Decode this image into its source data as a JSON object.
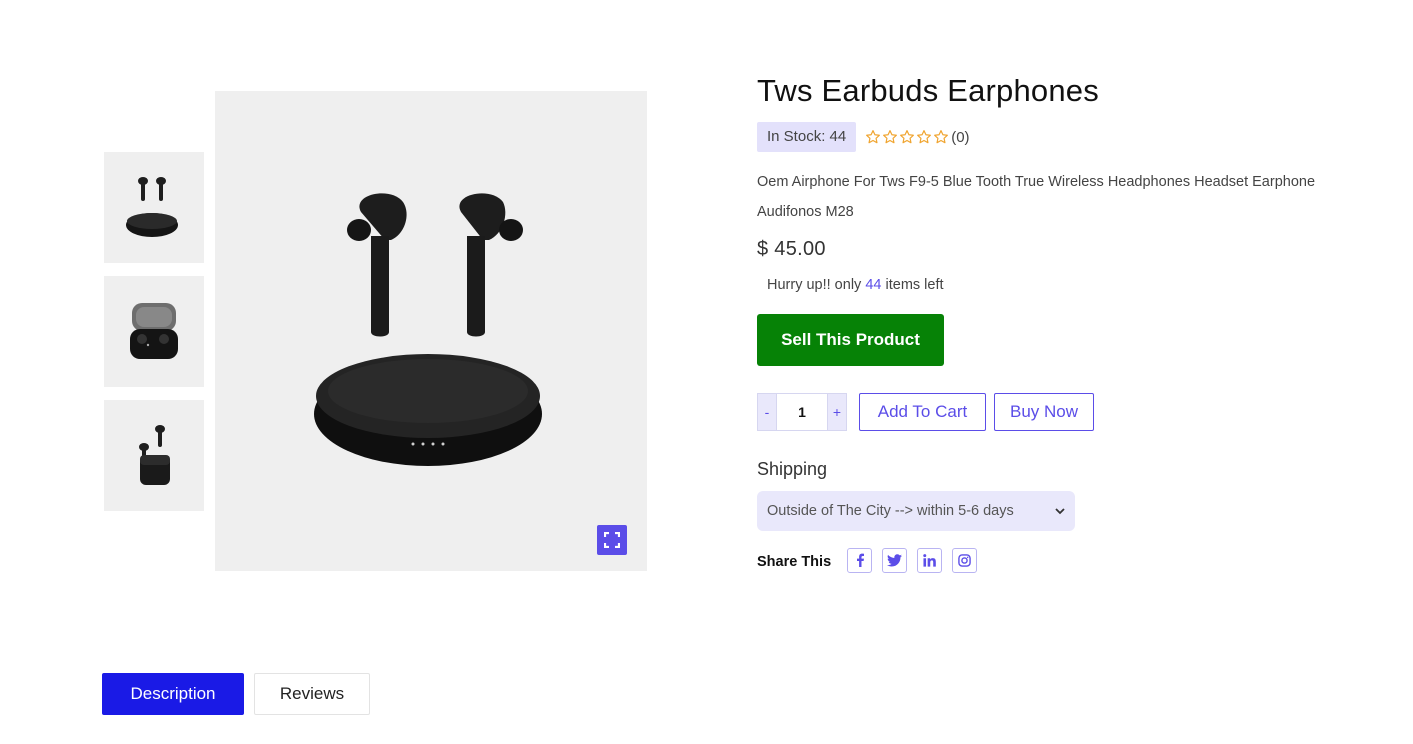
{
  "product": {
    "title": "Tws Earbuds Earphones",
    "stock_badge": "In Stock: 44",
    "rating_max": 5,
    "rating": 0,
    "review_count": "(0)",
    "description": "Oem Airphone For Tws F9-5 Blue Tooth True Wireless Headphones Headset Earphone Audifonos M28",
    "price": "$ 45.00",
    "hurry_prefix": "Hurry up!! only",
    "hurry_count": "44",
    "hurry_suffix": "items left"
  },
  "actions": {
    "sell_label": "Sell This Product",
    "qty_minus": "-",
    "qty_plus": "+",
    "qty_value": "1",
    "add_to_cart": "Add To Cart",
    "buy_now": "Buy Now"
  },
  "shipping": {
    "label": "Shipping",
    "selected": "Outside of The City --> within 5-6 days"
  },
  "share": {
    "label": "Share This",
    "networks": [
      "facebook-icon",
      "twitter-icon",
      "linkedin-icon",
      "instagram-icon"
    ]
  },
  "tabs": [
    {
      "label": "Description"
    },
    {
      "label": "Reviews"
    }
  ],
  "colors": {
    "accent": "#5b4de8",
    "sell_button": "#068206",
    "active_tab": "#1a1ae6",
    "star": "#f0a531"
  }
}
